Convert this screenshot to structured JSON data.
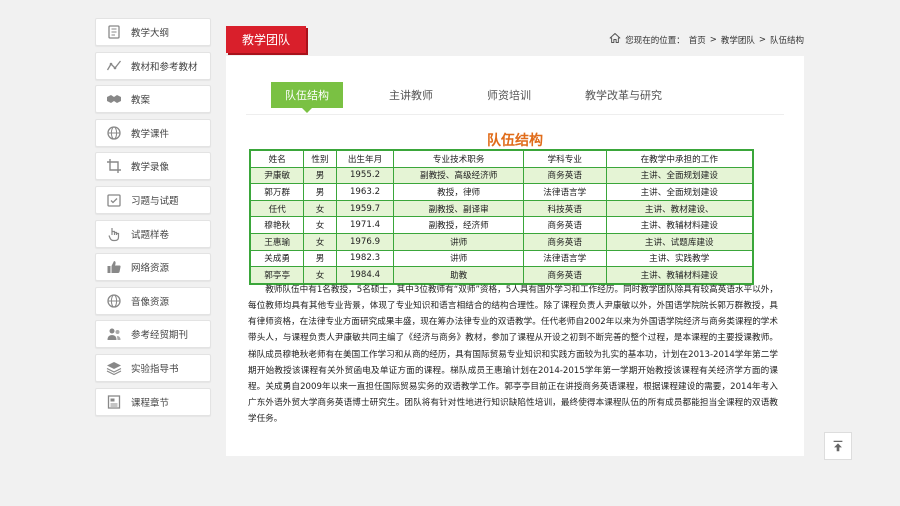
{
  "sidebar": {
    "items": [
      {
        "label": "教学大纲",
        "icon": "book-icon"
      },
      {
        "label": "教材和参考教材",
        "icon": "chart-line-icon"
      },
      {
        "label": "教案",
        "icon": "handshake-icon"
      },
      {
        "label": "教学课件",
        "icon": "globe-icon"
      },
      {
        "label": "教学录像",
        "icon": "crop-icon"
      },
      {
        "label": "习题与试题",
        "icon": "task-icon"
      },
      {
        "label": "试题样卷",
        "icon": "hand-pointer-icon"
      },
      {
        "label": "网络资源",
        "icon": "thumbs-up-icon"
      },
      {
        "label": "音像资源",
        "icon": "globe-icon"
      },
      {
        "label": "参考经贸期刊",
        "icon": "users-icon"
      },
      {
        "label": "实验指导书",
        "icon": "layers-icon"
      },
      {
        "label": "课程章节",
        "icon": "document-icon"
      }
    ]
  },
  "header": {
    "section": "教学团队",
    "breadcrumb": {
      "prefix": "您现在的位置：",
      "items": [
        "首页",
        "教学团队",
        "队伍结构"
      ],
      "separator": ">"
    }
  },
  "tabs": [
    {
      "label": "队伍结构",
      "active": true
    },
    {
      "label": "主讲教师",
      "active": false
    },
    {
      "label": "师资培训",
      "active": false
    },
    {
      "label": "教学改革与研究",
      "active": false
    }
  ],
  "content": {
    "title": "队伍结构",
    "table": {
      "headers": [
        "姓名",
        "性别",
        "出生年月",
        "专业技术职务",
        "学科专业",
        "在教学中承担的工作"
      ],
      "rows": [
        [
          "尹康敏",
          "男",
          "1955.2",
          "副教授、高级经济师",
          "商务英语",
          "主讲、全面规划建设"
        ],
        [
          "郭万群",
          "男",
          "1963.2",
          "教授，律师",
          "法律语言学",
          "主讲、全面规划建设"
        ],
        [
          "任代",
          "女",
          "1959.7",
          "副教授、副译审",
          "科技英语",
          "主讲、教材建设、"
        ],
        [
          "穆艳秋",
          "女",
          "1971.4",
          "副教授，经济师",
          "商务英语",
          "主讲、教辅材料建设"
        ],
        [
          "王惠瑜",
          "女",
          "1976.9",
          "讲师",
          "商务英语",
          "主讲、试题库建设"
        ],
        [
          "关成勇",
          "男",
          "1982.3",
          "讲师",
          "法律语言学",
          "主讲、实践教学"
        ],
        [
          "郭亭亭",
          "女",
          "1984.4",
          "助教",
          "商务英语",
          "主讲、教辅材料建设"
        ]
      ]
    },
    "paragraph": "教师队伍中有1名教授，5名硕士，其中3位教师有“双师”资格，5人具有国外学习和工作经历。同时教学团队除具有较高英语水平以外，每位教师均具有其他专业背景，体现了专业知识和语言相结合的结构合理性。除了课程负责人尹康敏以外，外国语学院院长郭万群教授，具有律师资格，在法律专业方面研究成果丰盛，现在筹办法律专业的双语教学。任代老师自2002年以来为外国语学院经济与商务类课程的学术带头人，与课程负责人尹康敏共同主编了《经济与商务》教材，参加了课程从开设之初到不断完善的整个过程，是本课程的主要授课教师。梯队成员穆艳秋老师有在美国工作学习和从商的经历，具有国际贸易专业知识和实践方面较为扎实的基本功，计划在2013-2014学年第二学期开始教授该课程有关外贸函电及单证方面的课程。梯队成员王惠瑜计划在2014-2015学年第一学期开始教授该课程有关经济学方面的课程。关成勇自2009年以来一直担任国际贸易实务的双语教学工作。郭亭亭目前正在讲授商务英语课程，根据课程建设的需要，2014年考入广东外语外贸大学商务英语博士研究生。团队将有针对性地进行知识缺陷性培训，最终使得本课程队伍的所有成员都能担当全课程的双语教学任务。"
  },
  "colors": {
    "accent_red": "#d91f2b",
    "accent_green": "#7ac143",
    "title_orange": "#e06c1a",
    "table_border": "#3aa63a"
  }
}
